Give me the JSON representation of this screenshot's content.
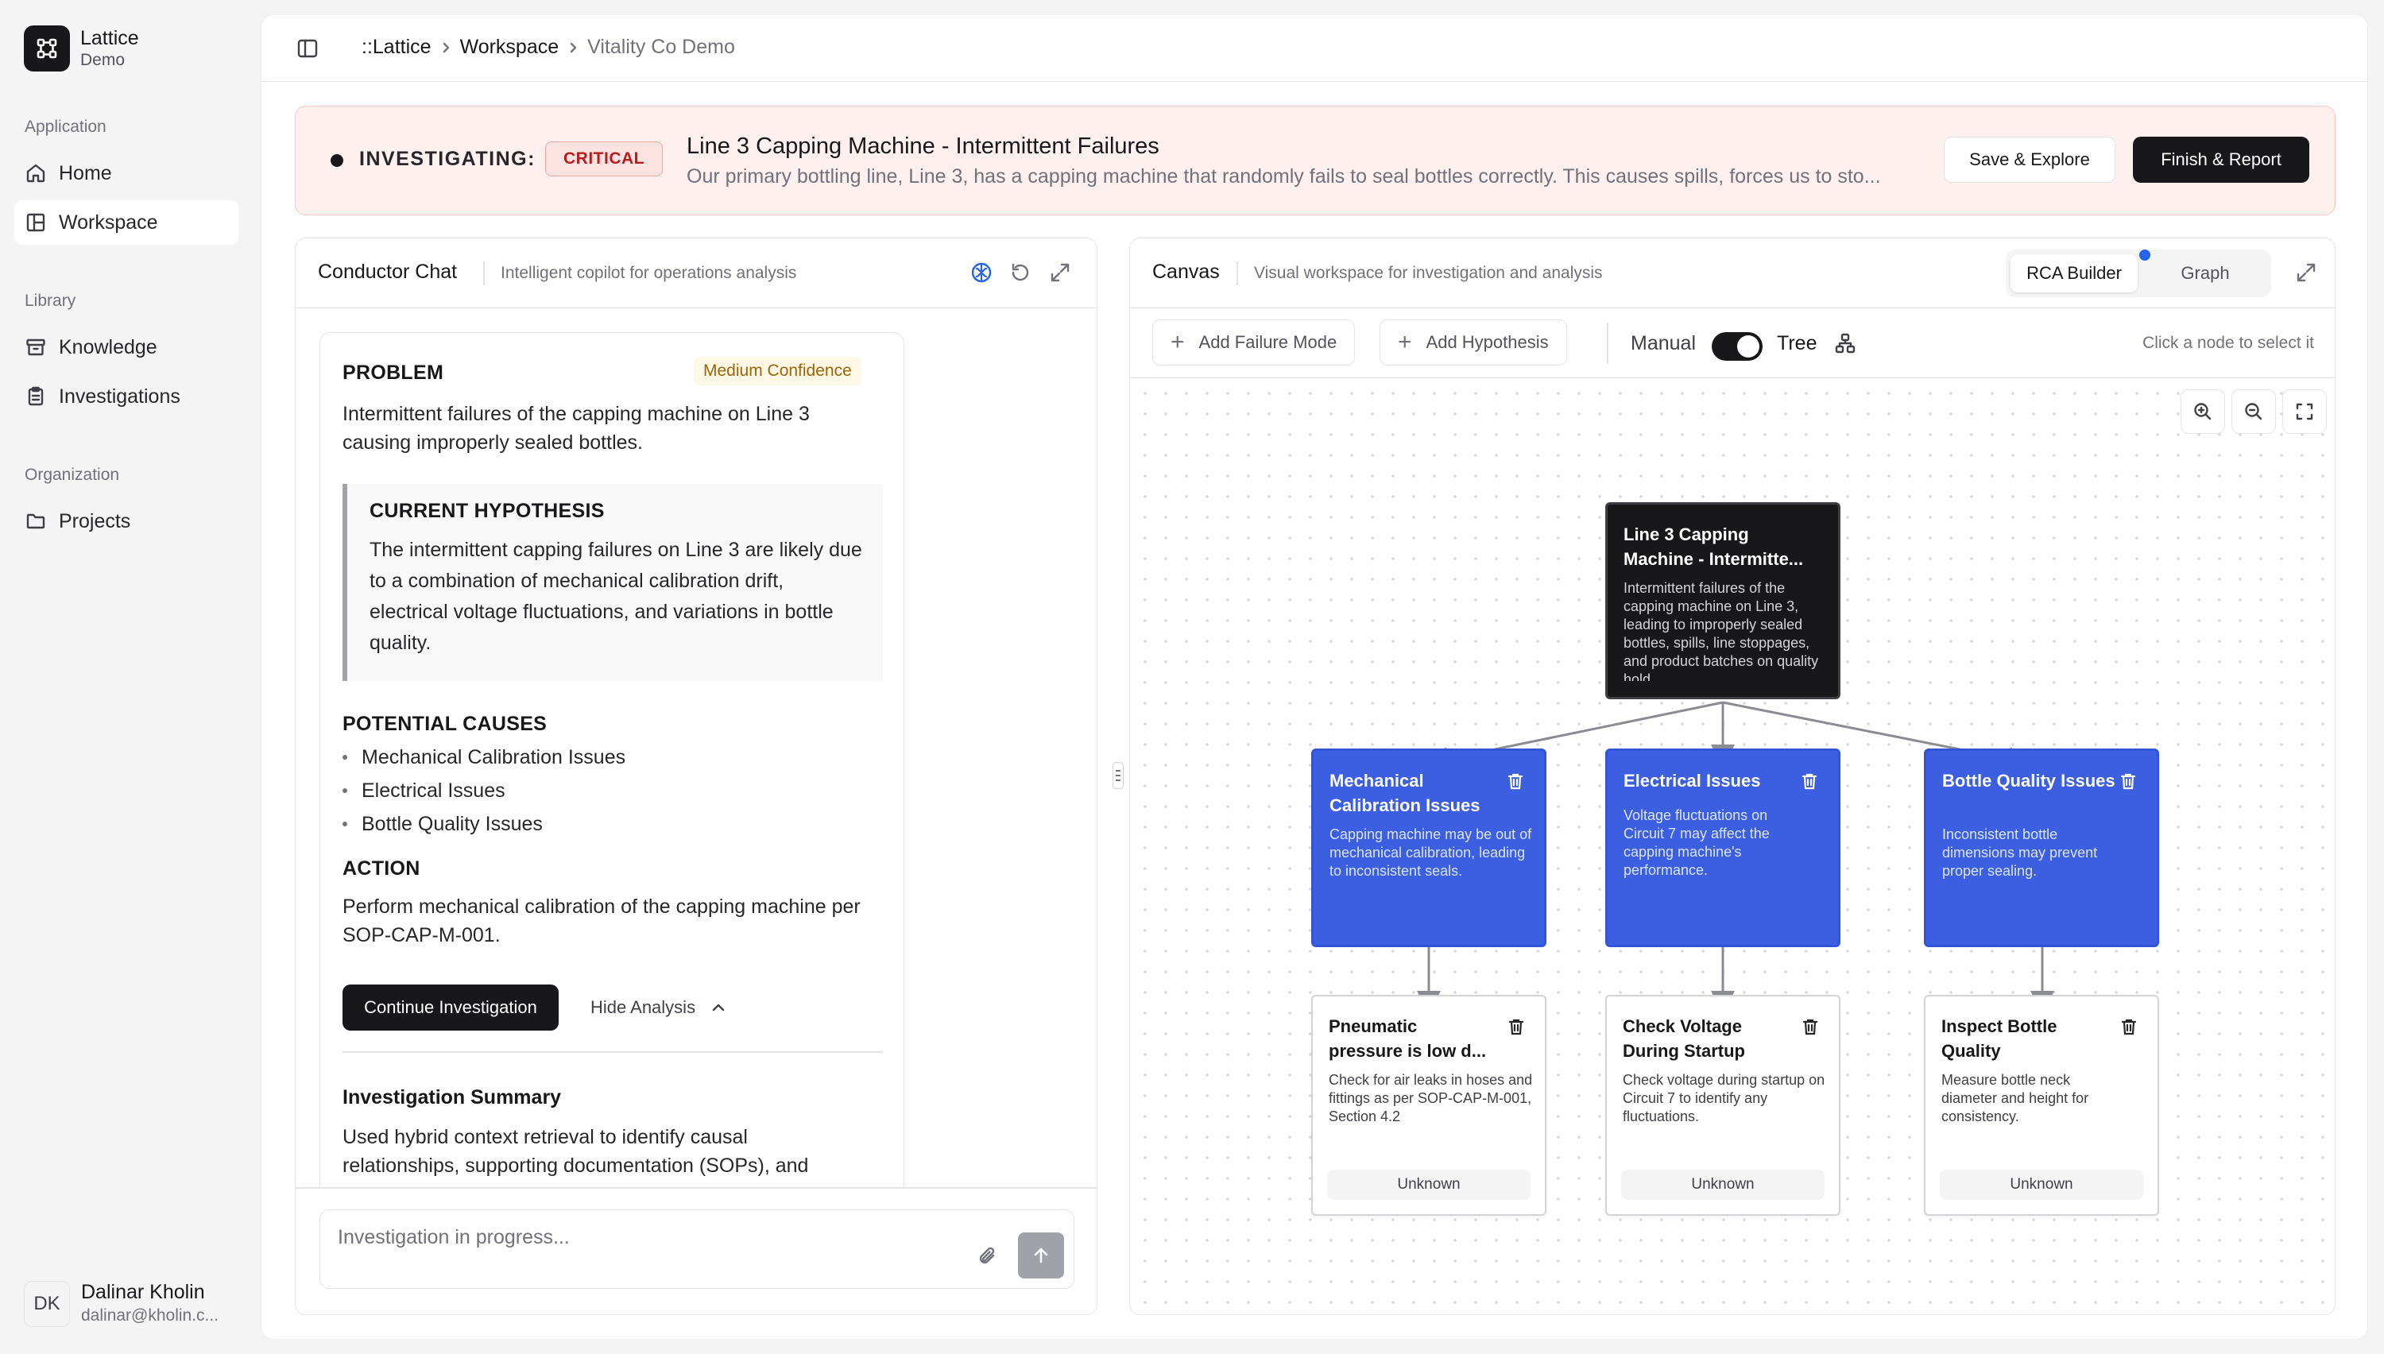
{
  "app": {
    "name": "Lattice",
    "subtitle": "Demo"
  },
  "sidebar": {
    "sections": [
      {
        "label": "Application",
        "items": [
          {
            "label": "Home",
            "icon": "home-icon"
          },
          {
            "label": "Workspace",
            "icon": "layout-icon",
            "active": true
          }
        ]
      },
      {
        "label": "Library",
        "items": [
          {
            "label": "Knowledge",
            "icon": "archive-icon"
          },
          {
            "label": "Investigations",
            "icon": "clipboard-icon"
          }
        ]
      },
      {
        "label": "Organization",
        "items": [
          {
            "label": "Projects",
            "icon": "folder-icon"
          }
        ]
      }
    ]
  },
  "user": {
    "initials": "DK",
    "name": "Dalinar Kholin",
    "email": "dalinar@kholin.c..."
  },
  "breadcrumb": {
    "root": "::Lattice",
    "middle": "Workspace",
    "current": "Vitality Co Demo"
  },
  "banner": {
    "status": "INVESTIGATING:",
    "severity": "CRITICAL",
    "title": "Line 3 Capping Machine - Intermittent Failures",
    "description": "Our primary bottling line, Line 3, has a capping machine that randomly fails to seal bottles correctly. This causes spills, forces us to sto...",
    "save_label": "Save & Explore",
    "finish_label": "Finish & Report"
  },
  "chat": {
    "title": "Conductor Chat",
    "subtitle": "Intelligent copilot for operations analysis",
    "card": {
      "problem_heading": "PROBLEM",
      "confidence": "Medium Confidence",
      "problem_text": "Intermittent failures of the capping machine on Line 3 causing improperly sealed bottles.",
      "hypothesis_heading": "CURRENT HYPOTHESIS",
      "hypothesis_text": "The intermittent capping failures on Line 3 are likely due to a combination of mechanical calibration drift, electrical voltage fluctuations, and variations in bottle quality.",
      "causes_heading": "POTENTIAL CAUSES",
      "causes": [
        "Mechanical Calibration Issues",
        "Electrical Issues",
        "Bottle Quality Issues"
      ],
      "action_heading": "ACTION",
      "action_text": "Perform mechanical calibration of the capping machine per SOP-CAP-M-001.",
      "continue_label": "Continue Investigation",
      "hide_label": "Hide Analysis",
      "summary_heading": "Investigation Summary",
      "summary_text": "Used hybrid context retrieval to identify causal relationships, supporting documentation (SOPs), and"
    },
    "input_placeholder": "Investigation in progress..."
  },
  "canvas": {
    "title": "Canvas",
    "subtitle": "Visual workspace for investigation and analysis",
    "tabs": [
      "RCA Builder",
      "Graph"
    ],
    "active_tab": "RCA Builder",
    "add_failure_label": "Add Failure Mode",
    "add_hypothesis_label": "Add Hypothesis",
    "mode_left": "Manual",
    "mode_right": "Tree",
    "hint": "Click a node to select it",
    "nodes": {
      "root": {
        "title": "Line 3 Capping Machine - Intermitte...",
        "desc": "Intermittent failures of the capping machine on Line 3, leading to improperly sealed bottles, spills, line stoppages, and product batches on quality hold"
      },
      "mech": {
        "title": "Mechanical Calibration Issues",
        "desc": "Capping machine may be out of mechanical calibration, leading to inconsistent seals."
      },
      "elec": {
        "title": "Electrical Issues",
        "desc": "Voltage fluctuations on Circuit 7 may affect the capping machine's performance."
      },
      "bottle": {
        "title": "Bottle Quality Issues",
        "desc": "Inconsistent bottle dimensions may prevent proper sealing."
      },
      "pneu": {
        "title": "Pneumatic pressure is low d...",
        "desc": "Check for air leaks in hoses and fittings as per SOP-CAP-M-001, Section 4.2",
        "status": "Unknown"
      },
      "volt": {
        "title": "Check Voltage During Startup",
        "desc": "Check voltage during startup on Circuit 7 to identify any fluctuations.",
        "status": "Unknown"
      },
      "inspect": {
        "title": "Inspect Bottle Quality",
        "desc": "Measure bottle neck diameter and height for consistency.",
        "status": "Unknown"
      }
    }
  },
  "colors": {
    "accent": "#3b5fe0",
    "dark": "#18181b",
    "critical": "#b91c1c",
    "banner_bg": "#fdf0ef"
  }
}
